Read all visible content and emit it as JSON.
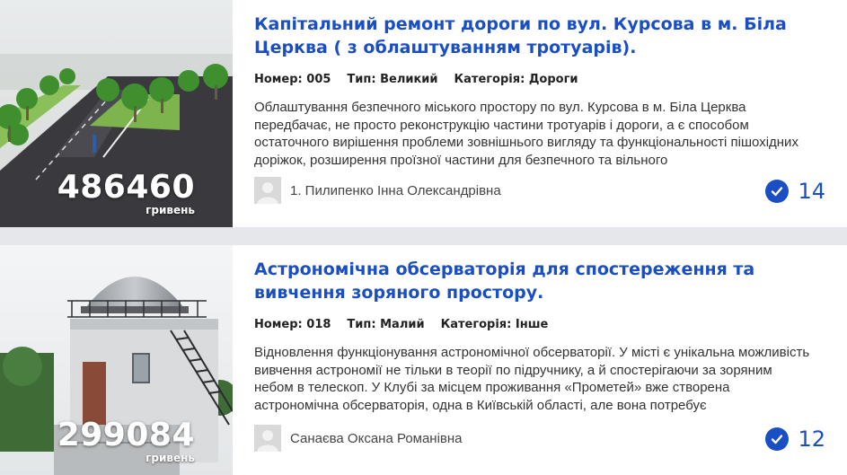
{
  "projects": [
    {
      "amount": "486460",
      "currency": "гривень",
      "title": "Капітальний ремонт дороги по вул. Курсова в м. Біла Церква ( з облаштуванням тротуарів).",
      "number": "Номер: 005",
      "type": "Тип: Великий",
      "category": "Категорія: Дороги",
      "description": "Облаштування безпечного міського простору по вул. Курсова в м. Біла Церква передбачає, не просто реконструкцію частини тротуарів і дороги, а є способом остаточного вирішення проблеми зовнішнього вигляду та функціональності пішохідних доріжок, розширення проїзної частини для безпечного та вільного",
      "author": "1. Пилипенко Інна Олександрівна",
      "votes": "14"
    },
    {
      "amount": "299084",
      "currency": "гривень",
      "title": "Астрономічна обсерваторія для спостереження та вивчення зоряного простору.",
      "number": "Номер: 018",
      "type": "Тип: Малий",
      "category": "Категорія: Інше",
      "description": "Відновлення функціонування астрономічної обсерваторії. У місті є унікальна можливість вивчення астрономії не тільки в теорії по підручнику, а й спостерігаючи за зоряним небом в телескоп. У Клубі за місцем проживання «Прометей» вже створена астрономічна обсерваторія, одна в Київській області, але вона потребує",
      "author": "Санаєва Оксана Романівна",
      "votes": "12"
    }
  ],
  "colors": {
    "accent": "#1a4ec3",
    "background": "#e6e7eb",
    "card": "#ffffff"
  },
  "icons": {
    "avatar": "user-avatar-placeholder",
    "vote": "check-circle-icon"
  }
}
